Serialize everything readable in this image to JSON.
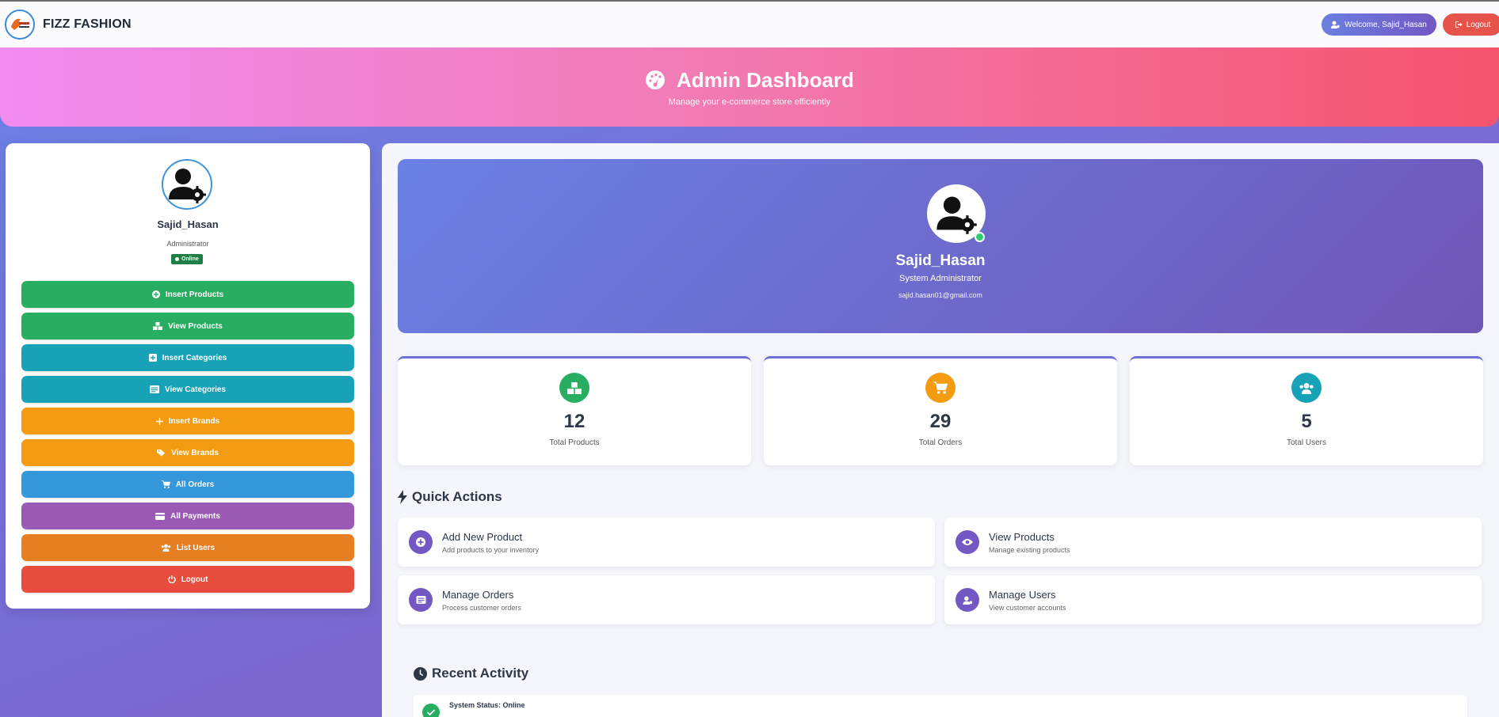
{
  "header": {
    "brand": "FIZZ FASHION",
    "logo_text": "FIZZ FASHION",
    "welcome_label": "Welcome, Sajid_Hasan",
    "logout_label": "Logout"
  },
  "hero": {
    "title": "Admin Dashboard",
    "subtitle": "Manage your e-commerce store efficiently",
    "icon": "tachometer-icon"
  },
  "sidebar": {
    "name": "Sajid_Hasan",
    "role": "Administrator",
    "status": "Online",
    "items": [
      {
        "label": "Insert Products",
        "icon": "plus-circle-icon",
        "color": "#27ae60"
      },
      {
        "label": "View Products",
        "icon": "boxes-icon",
        "color": "#27ae60"
      },
      {
        "label": "Insert Categories",
        "icon": "plus-square-icon",
        "color": "#17a2b8"
      },
      {
        "label": "View Categories",
        "icon": "list-icon",
        "color": "#17a2b8"
      },
      {
        "label": "Insert Brands",
        "icon": "plus-icon",
        "color": "#f39c12"
      },
      {
        "label": "View Brands",
        "icon": "tags-icon",
        "color": "#f39c12"
      },
      {
        "label": "All Orders",
        "icon": "cart-icon",
        "color": "#3498db"
      },
      {
        "label": "All Payments",
        "icon": "credit-card-icon",
        "color": "#9b59b6"
      },
      {
        "label": "List Users",
        "icon": "users-icon",
        "color": "#e67e22"
      },
      {
        "label": "Logout",
        "icon": "power-icon",
        "color": "#e74c3c"
      }
    ]
  },
  "profile": {
    "name": "Sajid_Hasan",
    "role": "System Administrator",
    "email": "sajid.hasan01@gmail.com"
  },
  "stats": [
    {
      "value": "12",
      "label": "Total Products",
      "icon": "boxes-icon",
      "color": "#27ae60"
    },
    {
      "value": "29",
      "label": "Total Orders",
      "icon": "cart-icon",
      "color": "#f39c12"
    },
    {
      "value": "5",
      "label": "Total Users",
      "icon": "users-icon",
      "color": "#17a2b8"
    }
  ],
  "quick_actions": {
    "title": "Quick Actions",
    "items": [
      {
        "title": "Add New Product",
        "desc": "Add products to your inventory",
        "icon": "plus-circle-icon"
      },
      {
        "title": "View Products",
        "desc": "Manage existing products",
        "icon": "eye-icon"
      },
      {
        "title": "Manage Orders",
        "desc": "Process customer orders",
        "icon": "list-alt-icon"
      },
      {
        "title": "Manage Users",
        "desc": "View customer accounts",
        "icon": "user-cog-icon"
      }
    ]
  },
  "recent_activity": {
    "title": "Recent Activity",
    "items": [
      {
        "text": "System Status: Online",
        "icon": "check-icon"
      }
    ]
  }
}
